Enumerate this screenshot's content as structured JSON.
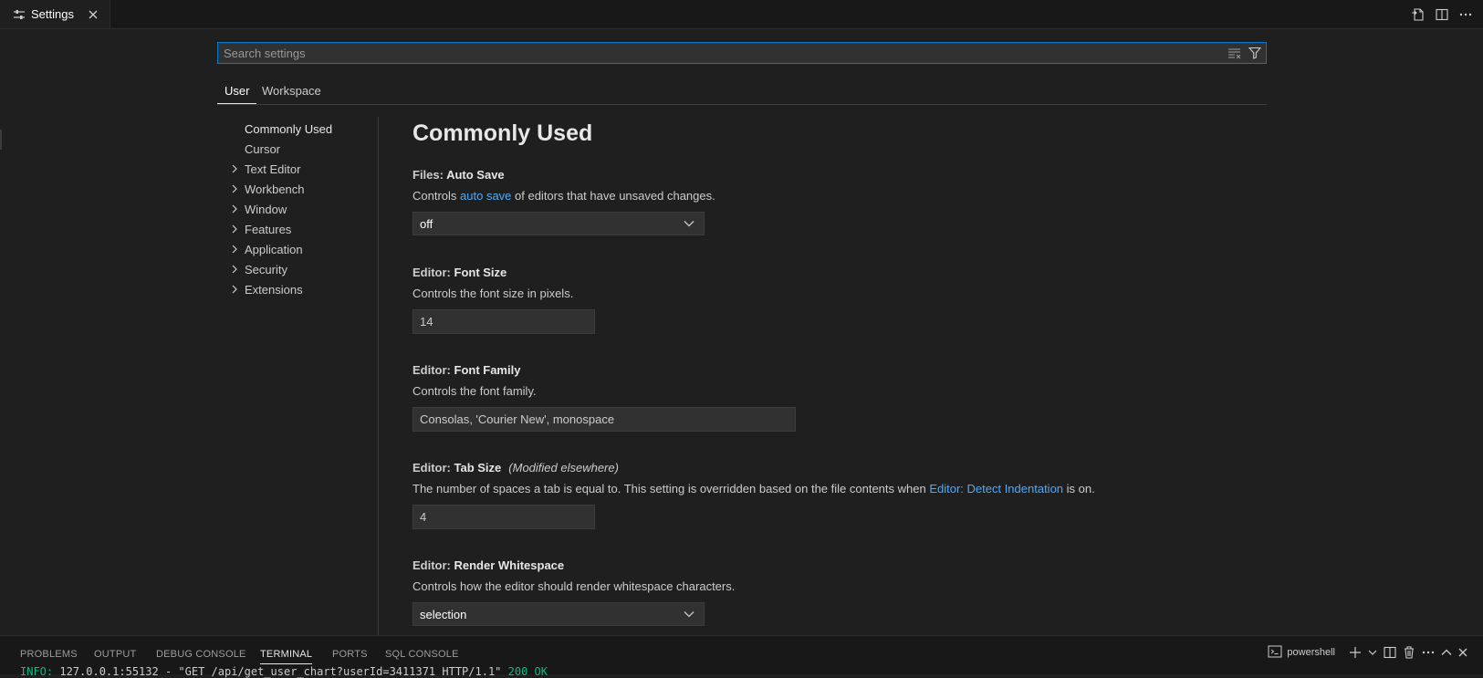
{
  "tab": {
    "label": "Settings",
    "icon": "settings-icon"
  },
  "search": {
    "placeholder": "Search settings"
  },
  "scope_tabs": [
    {
      "label": "User",
      "active": true
    },
    {
      "label": "Workspace",
      "active": false
    }
  ],
  "toc": [
    {
      "label": "Commonly Used",
      "expandable": false
    },
    {
      "label": "Cursor",
      "expandable": false
    },
    {
      "label": "Text Editor",
      "expandable": true
    },
    {
      "label": "Workbench",
      "expandable": true
    },
    {
      "label": "Window",
      "expandable": true
    },
    {
      "label": "Features",
      "expandable": true
    },
    {
      "label": "Application",
      "expandable": true
    },
    {
      "label": "Security",
      "expandable": true
    },
    {
      "label": "Extensions",
      "expandable": true
    }
  ],
  "section_title": "Commonly Used",
  "settings": {
    "auto_save": {
      "category": "Files: ",
      "name": "Auto Save",
      "desc_before": "Controls ",
      "desc_link": "auto save",
      "desc_after": " of editors that have unsaved changes.",
      "value": "off"
    },
    "font_size": {
      "category": "Editor: ",
      "name": "Font Size",
      "desc": "Controls the font size in pixels.",
      "value": "14"
    },
    "font_family": {
      "category": "Editor: ",
      "name": "Font Family",
      "desc": "Controls the font family.",
      "value": "Consolas, 'Courier New', monospace"
    },
    "tab_size": {
      "category": "Editor: ",
      "name": "Tab Size",
      "modified": "(Modified elsewhere)",
      "desc_before": "The number of spaces a tab is equal to. This setting is overridden based on the file contents when ",
      "desc_link": "Editor: Detect Indentation",
      "desc_after": " is on.",
      "value": "4"
    },
    "render_whitespace": {
      "category": "Editor: ",
      "name": "Render Whitespace",
      "desc": "Controls how the editor should render whitespace characters.",
      "value": "selection"
    }
  },
  "panel": {
    "tabs": [
      "PROBLEMS",
      "OUTPUT",
      "DEBUG CONSOLE",
      "TERMINAL",
      "PORTS",
      "SQL CONSOLE"
    ],
    "active_tab": "TERMINAL",
    "shell_label": "powershell",
    "terminal_line": {
      "level": "INFO:",
      "text": "     127.0.0.1:55132 - \"GET /api/get_user_chart?userId=3411371 HTTP/1.1\"",
      "status": "200 OK"
    }
  },
  "colors": {
    "accent": "#0078d4",
    "link": "#4daafc",
    "background": "#1f1f1f",
    "chrome": "#181818"
  }
}
